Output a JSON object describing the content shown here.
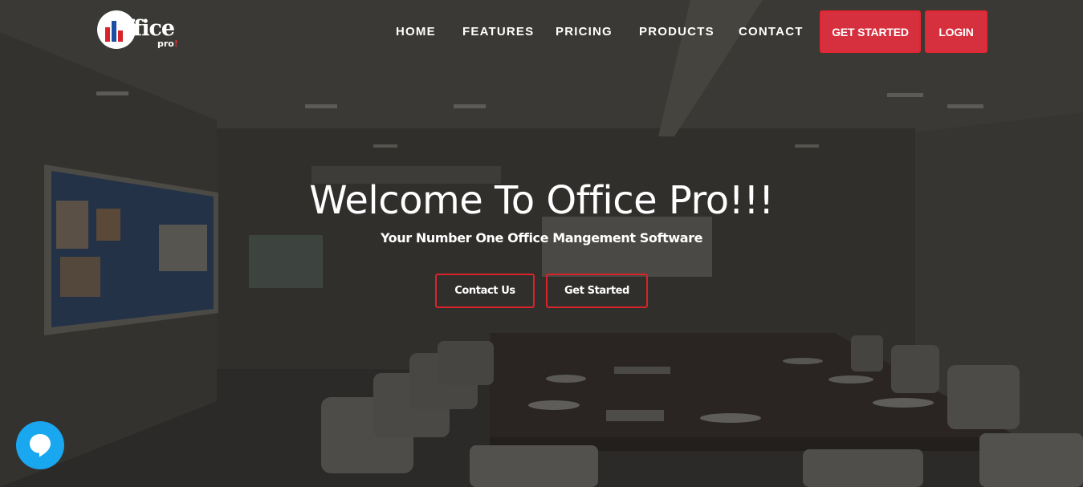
{
  "logo": {
    "word": "ffice",
    "sub": "pro",
    "sub_mark": "!"
  },
  "nav": {
    "items": [
      {
        "label": "HOME"
      },
      {
        "label": "FEATURES"
      },
      {
        "label": "PRICING"
      },
      {
        "label": "PRODUCTS"
      },
      {
        "label": "CONTACT"
      }
    ],
    "get_started": "GET STARTED",
    "login": "LOGIN"
  },
  "hero": {
    "title": "Welcome To Office Pro!!!",
    "subtitle": "Your Number One Office Mangement Software",
    "contact_button": "Contact Us",
    "get_started_button": "Get Started"
  },
  "chat": {
    "icon": "chat-bubble-icon"
  },
  "colors": {
    "accent_red": "#d6303f",
    "outline_red": "#d8232a",
    "chat_blue": "#19a7f0",
    "overlay": "#2b2a28"
  }
}
